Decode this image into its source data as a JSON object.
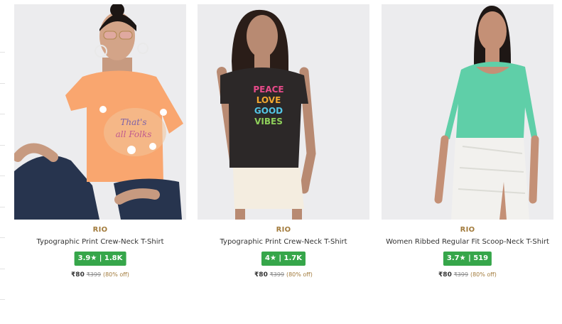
{
  "products": [
    {
      "brand": "RIO",
      "title": "Typographic Print Crew-Neck T-Shirt",
      "rating_value": "3.9",
      "rating_star": "★",
      "rating_count": "1.8K",
      "price": "₹80",
      "mrp": "₹399",
      "discount": "(80% off)",
      "shirt_color": "#f9a66f",
      "print_text": "That's all Folks"
    },
    {
      "brand": "RIO",
      "title": "Typographic Print Crew-Neck T-Shirt",
      "rating_value": "4",
      "rating_star": "★",
      "rating_count": "1.7K",
      "price": "₹80",
      "mrp": "₹399",
      "discount": "(80% off)",
      "shirt_color": "#2c2828",
      "print_text": "PEACE LOVE GOOD VIBES"
    },
    {
      "brand": "RIO",
      "title": "Women Ribbed Regular Fit Scoop-Neck T-Shirt",
      "rating_value": "3.7",
      "rating_star": "★",
      "rating_count": "519",
      "price": "₹80",
      "mrp": "₹399",
      "discount": "(80% off)",
      "shirt_color": "#5fcfa8",
      "print_text": ""
    }
  ],
  "colors": {
    "rating_bg": "#36a64a",
    "brand": "#a27b3c",
    "image_bg": "#ebebed"
  }
}
